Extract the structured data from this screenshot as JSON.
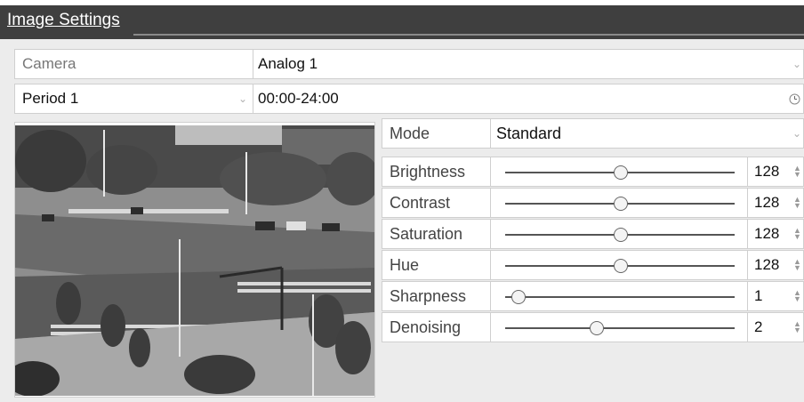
{
  "window": {
    "title": "Image Settings"
  },
  "camera": {
    "label": "Camera",
    "value": "Analog 1"
  },
  "period": {
    "value": "Period 1",
    "time_range": "00:00-24:00"
  },
  "mode": {
    "label": "Mode",
    "value": "Standard"
  },
  "sliders": [
    {
      "label": "Brightness",
      "value": "128",
      "level": 0.502
    },
    {
      "label": "Contrast",
      "value": "128",
      "level": 0.502
    },
    {
      "label": "Saturation",
      "value": "128",
      "level": 0.502
    },
    {
      "label": "Hue",
      "value": "128",
      "level": 0.502
    },
    {
      "label": "Sharpness",
      "value": "1",
      "level": 0.06
    },
    {
      "label": "Denoising",
      "value": "2",
      "level": 0.4
    }
  ],
  "icons": {
    "dropdown": "chevron-down-icon",
    "clock": "clock-icon",
    "spinner": "spinner-arrows-icon"
  }
}
